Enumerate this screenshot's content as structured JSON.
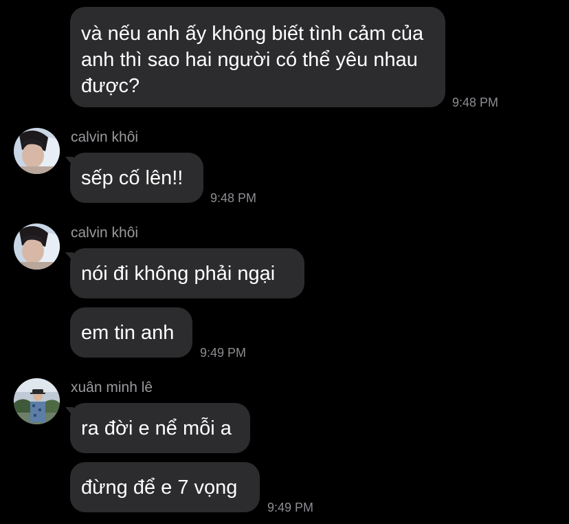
{
  "messages": {
    "outgoing": {
      "text": "và nếu anh ấy không biết tình cảm của anh thì sao hai người có thể yêu nhau được?",
      "time": "9:48 PM"
    },
    "group1": {
      "sender": "calvin khôi",
      "bubble1": "sếp cố lên!!",
      "time": "9:48 PM"
    },
    "group2": {
      "sender": "calvin khôi",
      "bubble1": "nói đi không phải ngại",
      "bubble2": "em tin anh",
      "time": "9:49 PM"
    },
    "group3": {
      "sender": "xuân minh lê",
      "bubble1": "ra đời e nể mỗi a",
      "bubble2": "đừng để e 7 vọng",
      "time": "9:49 PM"
    }
  },
  "colors": {
    "background": "#000000",
    "bubble": "#2c2c2e",
    "text": "#ffffff",
    "meta": "#8e8e93"
  }
}
